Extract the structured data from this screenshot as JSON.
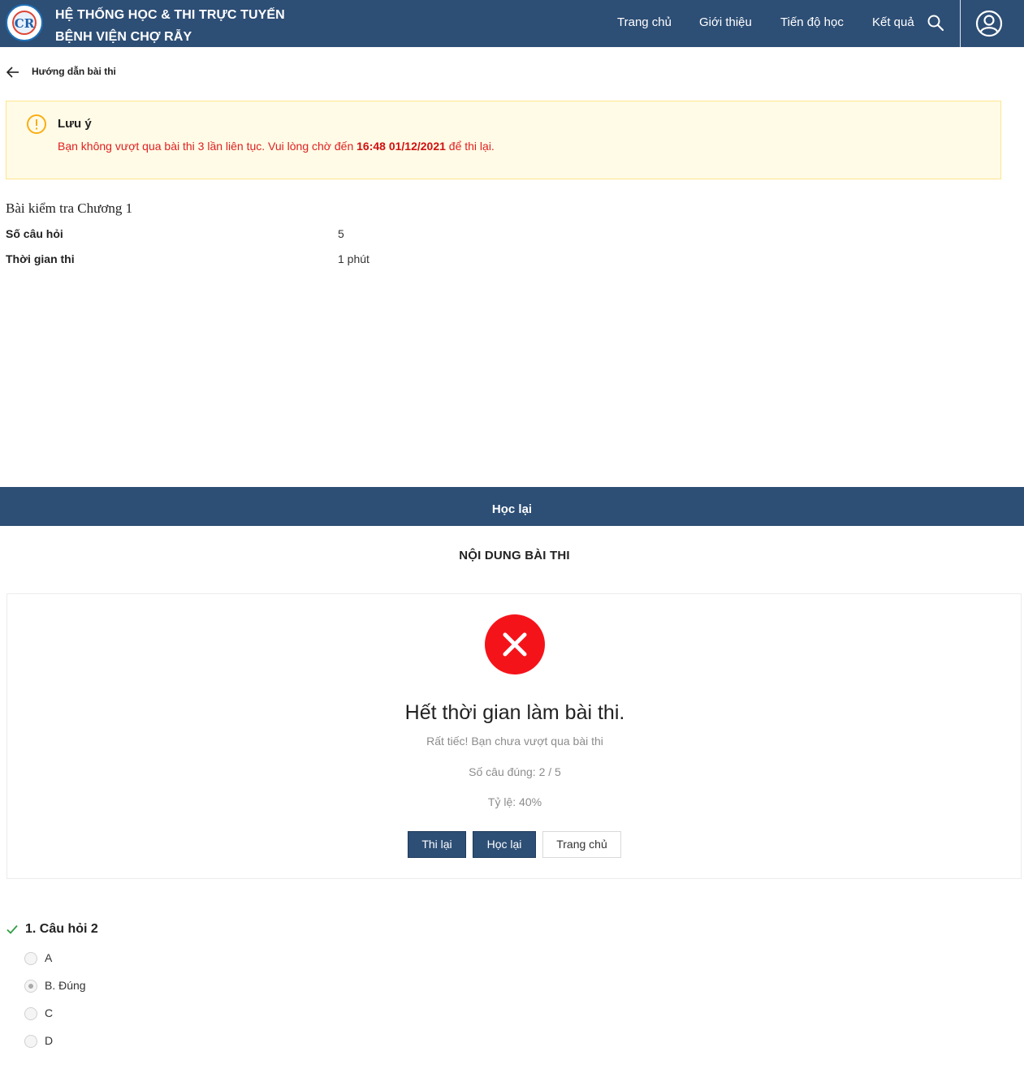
{
  "header": {
    "title_line1": "HỆ THỐNG HỌC & THI TRỰC TUYẾN",
    "title_line2": "BỆNH VIỆN CHỢ RẪY",
    "nav": [
      "Trang chủ",
      "Giới thiệu",
      "Tiến độ học",
      "Kết quả"
    ],
    "colors": {
      "primary": "#2d4e75"
    }
  },
  "breadcrumb": {
    "back_label": "Hướng dẫn bài thi"
  },
  "notice": {
    "title": "Lưu ý",
    "message_prefix": "Bạn không vượt qua bài thi 3 lần liên tục. Vui lòng chờ đến ",
    "deadline": "16:48 01/12/2021",
    "message_suffix": " để thi lại."
  },
  "exam": {
    "title": "Bài kiểm tra Chương 1",
    "question_count_label": "Số câu hỏi",
    "question_count": "5",
    "duration_label": "Thời gian thi",
    "duration": "1 phút"
  },
  "review_bar": {
    "label": "Học lại"
  },
  "content_heading": "NỘI DUNG BÀI THI",
  "result": {
    "title": "Hết thời gian làm bài thi.",
    "subtitle": "Rất tiếc! Bạn chưa vượt qua bài thi",
    "correct": "Số câu đúng: 2 / 5",
    "ratio": "Tỷ lệ: 40%",
    "buttons": {
      "retry": "Thi lại",
      "relearn": "Học lại",
      "home": "Trang chủ"
    }
  },
  "question": {
    "title": "1. Câu hỏi 2",
    "options": [
      {
        "label": "A",
        "selected": false
      },
      {
        "label": "B. Đúng",
        "selected": true
      },
      {
        "label": "C",
        "selected": false
      },
      {
        "label": "D",
        "selected": false
      }
    ]
  }
}
